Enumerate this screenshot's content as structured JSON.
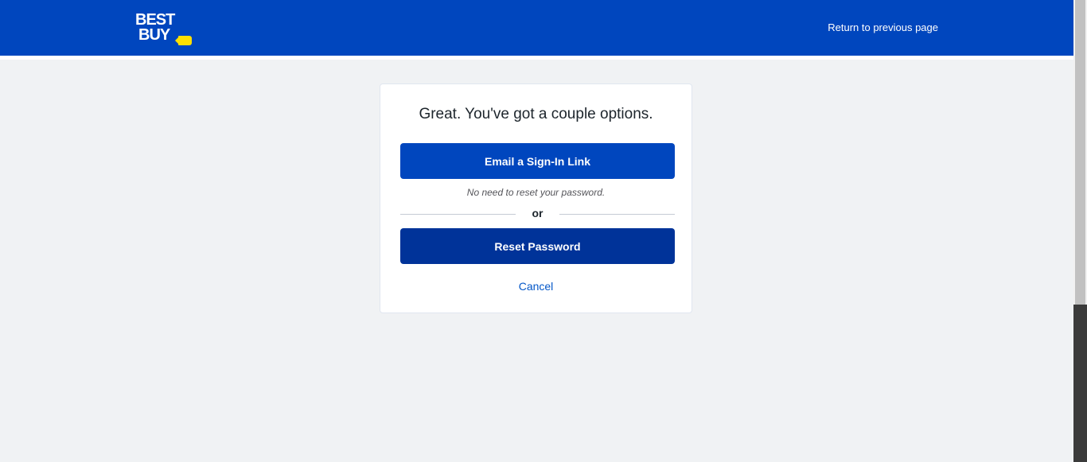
{
  "header": {
    "logo_line1": "BEST",
    "logo_line2": "BUY",
    "logo_text": "BEST BUY",
    "return_link": "Return to previous page",
    "background_color": "#0046be",
    "tag_color": "#ffe000"
  },
  "card": {
    "title": "Great. You've got a couple options.",
    "email_button": "Email a Sign-In Link",
    "hint": "No need to reset your password.",
    "divider_text": "or",
    "reset_button": "Reset Password",
    "cancel_link": "Cancel"
  },
  "colors": {
    "primary": "#0046be",
    "primary_dark": "#003399",
    "link": "#0457c8",
    "page_background": "#f0f2f4"
  }
}
